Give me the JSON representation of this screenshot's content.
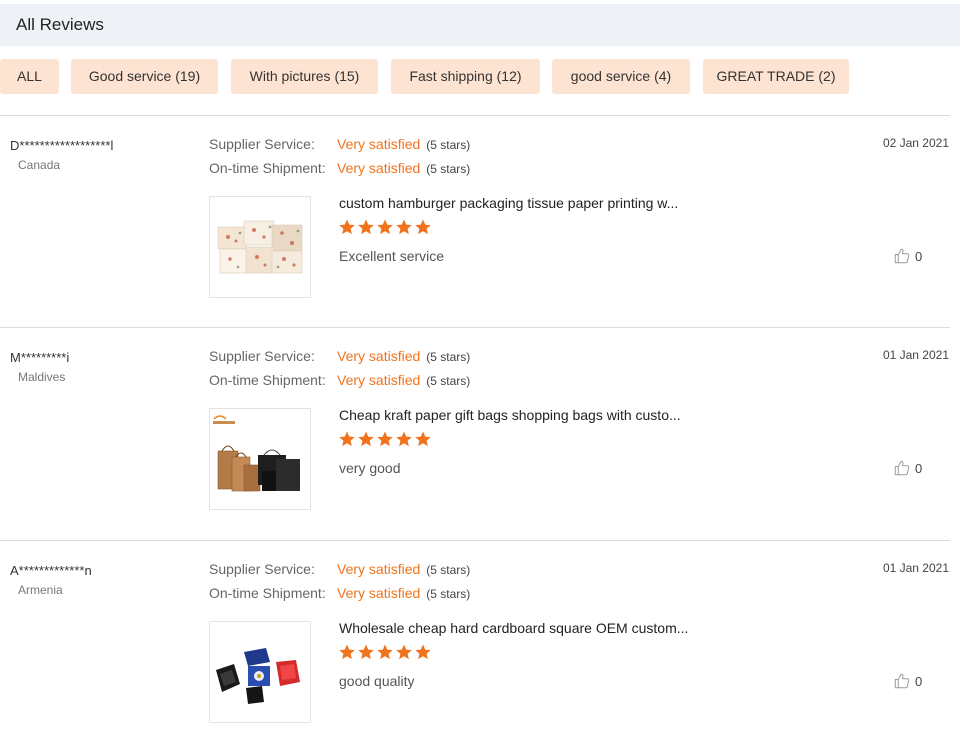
{
  "header": {
    "title": "All Reviews"
  },
  "filters": [
    {
      "label": "ALL"
    },
    {
      "label": "Good service (19)"
    },
    {
      "label": "With pictures (15)"
    },
    {
      "label": "Fast shipping (12)"
    },
    {
      "label": "good service (4)"
    },
    {
      "label": "GREAT TRADE (2)"
    }
  ],
  "colors": {
    "accent": "#f0731e",
    "chip_bg": "#fde3d2",
    "header_bg": "#eef1f6"
  },
  "reviews": [
    {
      "reviewer": "D******************l",
      "country": "Canada",
      "supplier_label": "Supplier Service:",
      "supplier_value": "Very satisfied",
      "supplier_stars": "(5 stars)",
      "shipment_label": "On-time Shipment:",
      "shipment_value": "Very satisfied",
      "shipment_stars": "(5 stars)",
      "date": "02 Jan 2021",
      "product_title": "custom hamburger packaging tissue paper printing w...",
      "rating": 5,
      "comment": "Excellent service",
      "likes": "0",
      "thumb_icon": "tissue-paper-product-image"
    },
    {
      "reviewer": "M*********i",
      "country": "Maldives",
      "supplier_label": "Supplier Service:",
      "supplier_value": "Very satisfied",
      "supplier_stars": "(5 stars)",
      "shipment_label": "On-time Shipment:",
      "shipment_value": "Very satisfied",
      "shipment_stars": "(5 stars)",
      "date": "01 Jan 2021",
      "product_title": "Cheap kraft paper gift bags shopping bags with custo...",
      "rating": 5,
      "comment": "very good",
      "likes": "0",
      "thumb_icon": "kraft-bags-product-image"
    },
    {
      "reviewer": "A*************n",
      "country": "Armenia",
      "supplier_label": "Supplier Service:",
      "supplier_value": "Very satisfied",
      "supplier_stars": "(5 stars)",
      "shipment_label": "On-time Shipment:",
      "shipment_value": "Very satisfied",
      "shipment_stars": "(5 stars)",
      "date": "01 Jan 2021",
      "product_title": "Wholesale cheap hard cardboard square OEM custom...",
      "rating": 5,
      "comment": "good quality",
      "likes": "0",
      "thumb_icon": "gift-boxes-product-image"
    }
  ]
}
